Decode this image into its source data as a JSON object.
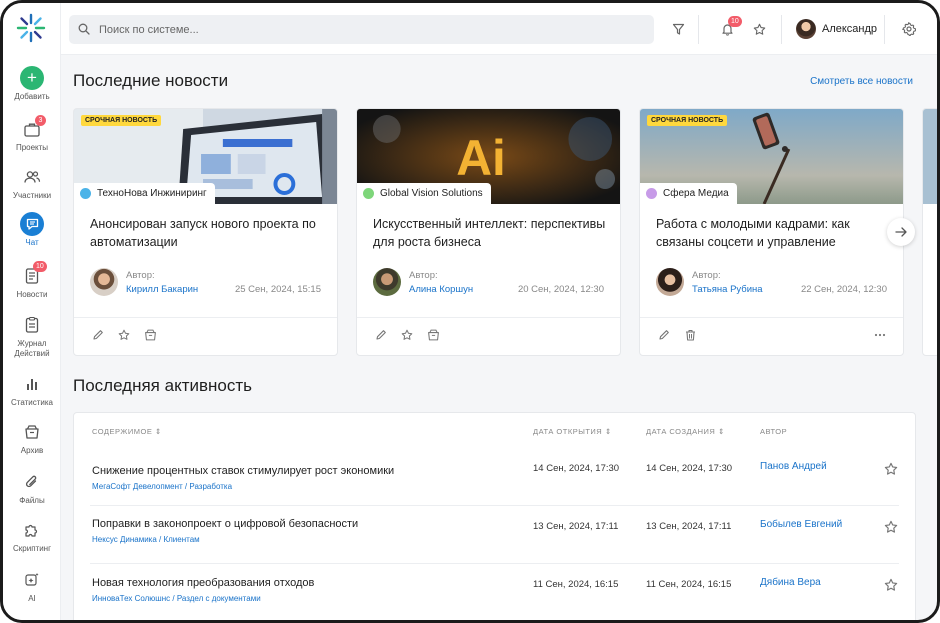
{
  "sidebar": {
    "items": [
      {
        "label": "Добавить",
        "icon": "plus-icon"
      },
      {
        "label": "Проекты",
        "icon": "briefcase-icon",
        "badge": "3"
      },
      {
        "label": "Участники",
        "icon": "users-icon"
      },
      {
        "label": "Чат",
        "icon": "chat-icon",
        "active": true
      },
      {
        "label": "Новости",
        "icon": "news-icon",
        "badge": "10"
      },
      {
        "label": "Журнал",
        "label2": "Действий",
        "icon": "journal-icon"
      },
      {
        "label": "Статистика",
        "icon": "bar-chart-icon"
      },
      {
        "label": "Архив",
        "icon": "archive-icon"
      },
      {
        "label": "Файлы",
        "icon": "paperclip-icon"
      },
      {
        "label": "Скриптинг",
        "icon": "puzzle-icon"
      },
      {
        "label": "AI",
        "icon": "ai-sparkle-icon"
      }
    ]
  },
  "topbar": {
    "search_placeholder": "Поиск по системе...",
    "notifications_badge": "10",
    "user_name": "Александр"
  },
  "news": {
    "title": "Последние новости",
    "see_all": "Смотреть все новости",
    "urgent_label": "СРОЧНАЯ НОВОСТЬ",
    "author_label": "Автор:",
    "cards": [
      {
        "urgent": true,
        "company": "ТехноНова Инжиниринг",
        "dot_color": "#4bb3e8",
        "title": "Анонсирован запуск нового проекта по автоматизации",
        "author": "Кирилл Бакарин",
        "date": "25 Сен, 2024, 15:15"
      },
      {
        "urgent": false,
        "company": "Global Vision Solutions",
        "dot_color": "#7ed67a",
        "title": "Искусственный интеллект: перспективы для роста бизнеса",
        "author": "Алина Коршун",
        "date": "20 Сен, 2024, 12:30"
      },
      {
        "urgent": true,
        "company": "Сфера Медиа",
        "dot_color": "#c79be8",
        "title": "Работа с молодыми кадрами: как связаны соцсети и управление",
        "author": "Татьяна Рубина",
        "date": "22 Сен, 2024, 12:30"
      }
    ]
  },
  "activity": {
    "title": "Последняя активность",
    "columns": [
      "Содержимое",
      "Дата открытия",
      "Дата создания",
      "Автор"
    ],
    "rows": [
      {
        "title": "Снижение процентных ставок стимулирует рост экономики",
        "company": "МегаСофт Девелопмент",
        "folder": "Разработка",
        "opened": "14 Сен, 2024, 17:30",
        "created": "14 Сен, 2024, 17:30",
        "author": "Панов Андрей"
      },
      {
        "title": "Поправки в законопроект о цифровой безопасности",
        "company": "Нексус Динамика",
        "folder": "Клиентам",
        "opened": "13 Сен, 2024, 17:11",
        "created": "13 Сен, 2024, 17:11",
        "author": "Бобылев Евгений"
      },
      {
        "title": "Новая технология преобразования отходов",
        "company": "ИнноваТех Солюшнс",
        "folder": "Раздел с документами",
        "opened": "11 Сен, 2024, 16:15",
        "created": "11 Сен, 2024, 16:15",
        "author": "Дябина Вера"
      }
    ]
  },
  "colors": {
    "accent": "#1a73c9",
    "add": "#2bb673",
    "badge": "#f25c69",
    "urgent": "#ffd83d"
  }
}
